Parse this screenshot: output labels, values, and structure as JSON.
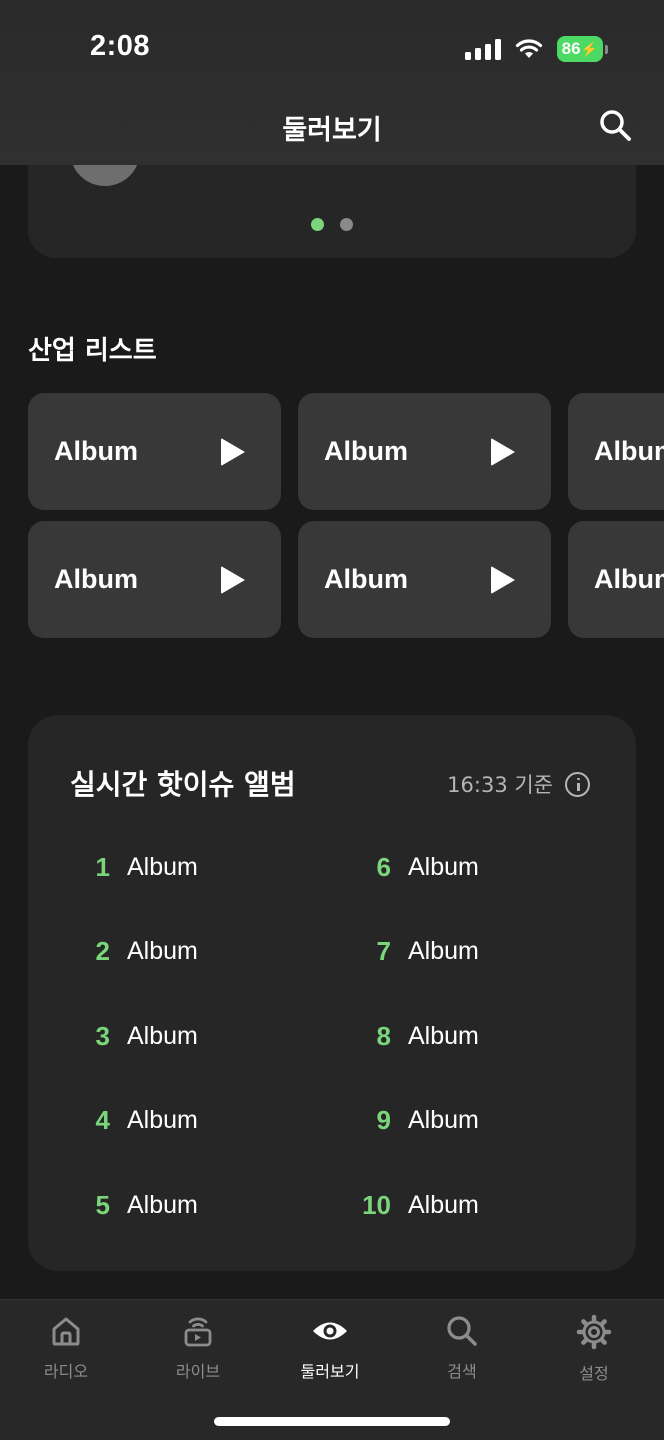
{
  "status_bar": {
    "time": "2:08",
    "battery": "86"
  },
  "header": {
    "title": "둘러보기"
  },
  "carousel": {
    "dot_count": 2,
    "active_dot": 0
  },
  "industry_list": {
    "title": "산업 리스트",
    "albums": [
      "Album",
      "Album",
      "Album",
      "Album",
      "Album",
      "Album"
    ]
  },
  "hot_issue": {
    "title": "실시간 핫이슈 앨범",
    "timestamp": "16:33 기준",
    "left": [
      {
        "rank": "1",
        "name": "Album"
      },
      {
        "rank": "2",
        "name": "Album"
      },
      {
        "rank": "3",
        "name": "Album"
      },
      {
        "rank": "4",
        "name": "Album"
      },
      {
        "rank": "5",
        "name": "Album"
      }
    ],
    "right": [
      {
        "rank": "6",
        "name": "Album"
      },
      {
        "rank": "7",
        "name": "Album"
      },
      {
        "rank": "8",
        "name": "Album"
      },
      {
        "rank": "9",
        "name": "Album"
      },
      {
        "rank": "10",
        "name": "Album"
      }
    ]
  },
  "tabbar": {
    "tabs": [
      {
        "label": "라디오",
        "icon": "home-icon"
      },
      {
        "label": "라이브",
        "icon": "live-broadcast-icon"
      },
      {
        "label": "둘러보기",
        "icon": "eye-icon"
      },
      {
        "label": "검색",
        "icon": "search-icon"
      },
      {
        "label": "설정",
        "icon": "gear-icon"
      }
    ],
    "active": 2
  },
  "colors": {
    "accent": "#7bd67b",
    "background": "#1a1a1a",
    "card": "#262626",
    "tile": "#383838"
  }
}
